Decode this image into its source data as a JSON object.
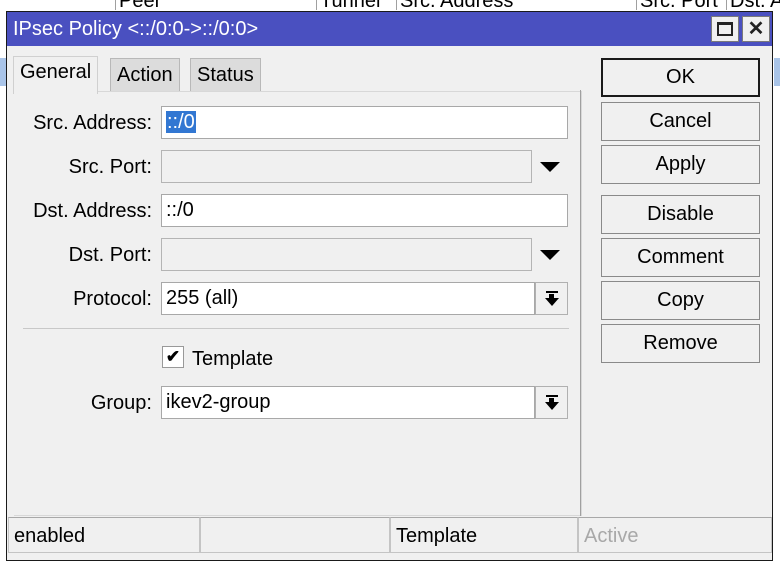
{
  "background_table": {
    "columns": [
      "Peer",
      "Tunnel",
      "Src. Address",
      "Src. Port",
      "Dst. A"
    ]
  },
  "window": {
    "title": "IPsec Policy <::/0:0->::/0:0>",
    "maximize_icon": "maximize-icon",
    "close_icon": "close-icon",
    "close_glyph": "✕"
  },
  "tabs": [
    {
      "label": "General",
      "active": true
    },
    {
      "label": "Action",
      "active": false
    },
    {
      "label": "Status",
      "active": false
    }
  ],
  "form": {
    "src_address": {
      "label": "Src. Address:",
      "value": "::/0",
      "selected": true
    },
    "src_port": {
      "label": "Src. Port:",
      "value": ""
    },
    "dst_address": {
      "label": "Dst. Address:",
      "value": "::/0"
    },
    "dst_port": {
      "label": "Dst. Port:",
      "value": ""
    },
    "protocol": {
      "label": "Protocol:",
      "value": "255 (all)"
    },
    "template": {
      "label": "Template",
      "checked": true,
      "check_glyph": "✔"
    },
    "group": {
      "label": "Group:",
      "value": "ikev2-group"
    }
  },
  "buttons": {
    "ok": "OK",
    "cancel": "Cancel",
    "apply": "Apply",
    "disable": "Disable",
    "comment": "Comment",
    "copy": "Copy",
    "remove": "Remove"
  },
  "statusbar": {
    "cells": [
      "enabled",
      "",
      "Template",
      "Active"
    ],
    "colors": {
      "active_dim": "#a8a8a8"
    }
  },
  "colors": {
    "titlebar": "#4a50c0",
    "selection": "#3277d2",
    "window_bg": "#f0f0f0"
  }
}
